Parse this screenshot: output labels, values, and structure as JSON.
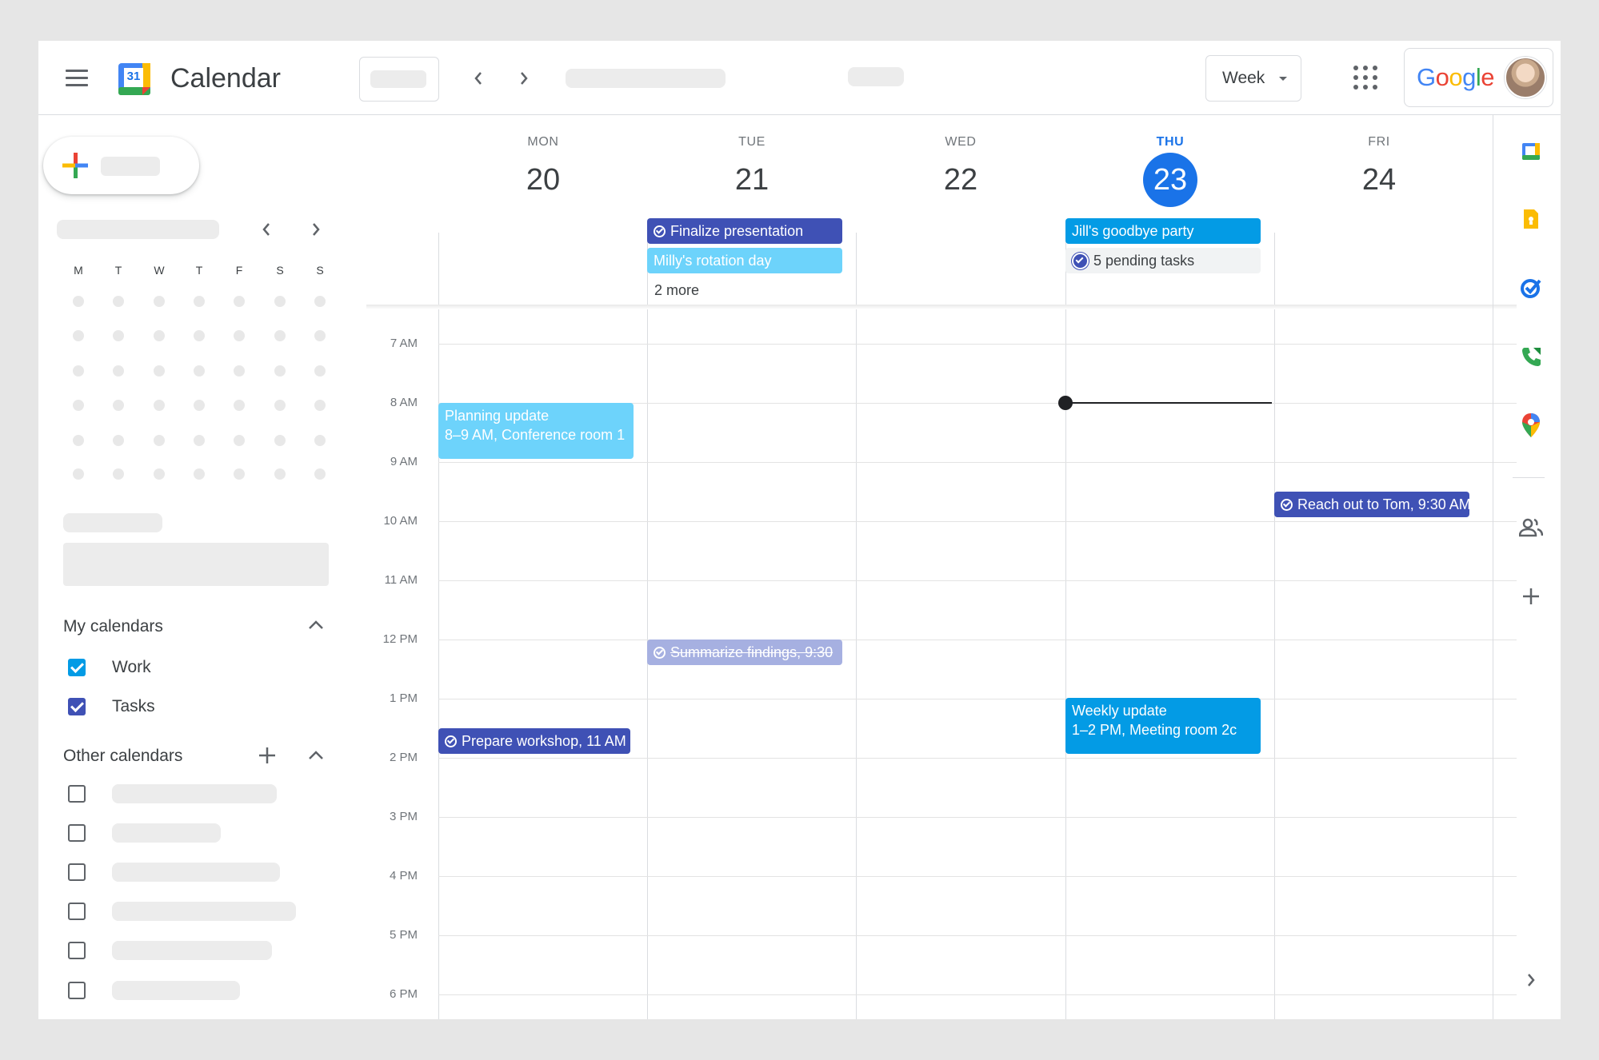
{
  "app": {
    "title": "Calendar",
    "logo_text": "31",
    "google_label": "Google",
    "colors": {
      "accent": "#1a73e8",
      "peacock": "#039be5",
      "lavender": "#3f51b5",
      "sky": "#6dd3fb"
    }
  },
  "view": {
    "selector": "Week"
  },
  "days": [
    {
      "dow": "MON",
      "num": "20"
    },
    {
      "dow": "TUE",
      "num": "21"
    },
    {
      "dow": "WED",
      "num": "22"
    },
    {
      "dow": "THU",
      "num": "23",
      "today": true
    },
    {
      "dow": "FRI",
      "num": "24"
    }
  ],
  "mini": {
    "dow": [
      "M",
      "T",
      "W",
      "T",
      "F",
      "S",
      "S"
    ]
  },
  "allday": {
    "finalize": "Finalize presentation",
    "milly": "Milly's rotation day",
    "more": "2 more",
    "jill": "Jill's goodbye party",
    "pending": "5 pending tasks"
  },
  "times": [
    "7 AM",
    "8 AM",
    "9 AM",
    "10 AM",
    "11 AM",
    "12 PM",
    "1 PM",
    "2 PM",
    "3 PM",
    "4 PM",
    "5 PM",
    "6 PM"
  ],
  "events": {
    "planning": {
      "title": "Planning update",
      "sub": "8–9 AM, Conference room 1"
    },
    "reach": {
      "title": "Reach out to Tom, 9:30 AM"
    },
    "summarize": {
      "title": "Summarize findings, 9:30"
    },
    "prepare": {
      "title": "Prepare workshop, 11 AM"
    },
    "weekly": {
      "title": "Weekly update",
      "sub": "1–2 PM, Meeting room 2c"
    }
  },
  "sidebar": {
    "my_calendars": "My calendars",
    "work": "Work",
    "tasks": "Tasks",
    "other_calendars": "Other calendars"
  }
}
